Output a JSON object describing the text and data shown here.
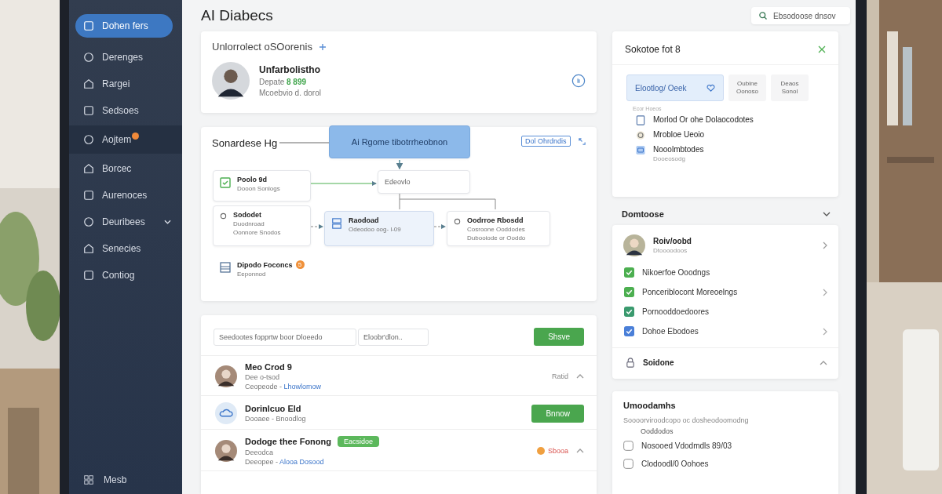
{
  "sidebar": {
    "items": [
      {
        "label": "Dohen fers",
        "selected": true,
        "highlighted": false,
        "badge": false,
        "expandable": false
      },
      {
        "label": "Derenges",
        "selected": false,
        "highlighted": false,
        "badge": false,
        "expandable": false
      },
      {
        "label": "Rargei",
        "selected": false,
        "highlighted": false,
        "badge": false,
        "expandable": false
      },
      {
        "label": "Sedsoes",
        "selected": false,
        "highlighted": false,
        "badge": false,
        "expandable": false
      },
      {
        "label": "Aojtem",
        "selected": false,
        "highlighted": true,
        "badge": true,
        "expandable": false
      },
      {
        "label": "Borcec",
        "selected": false,
        "highlighted": false,
        "badge": false,
        "expandable": false
      },
      {
        "label": "Aurenoces",
        "selected": false,
        "highlighted": false,
        "badge": false,
        "expandable": false
      },
      {
        "label": "Deuribees",
        "selected": false,
        "highlighted": false,
        "badge": false,
        "expandable": true
      },
      {
        "label": "Senecies",
        "selected": false,
        "highlighted": false,
        "badge": false,
        "expandable": false
      },
      {
        "label": "Contiog",
        "selected": false,
        "highlighted": false,
        "badge": false,
        "expandable": false
      }
    ],
    "footer": "Mesb"
  },
  "title": "AI Diabecs",
  "search": {
    "placeholder": "Ebsodoose dnsov"
  },
  "profile_card": {
    "title": "Unlorrolect oSOorenis",
    "name": "Unfarbolistho",
    "meta": "Depate",
    "meta_value": "8 899",
    "note": "Mcoebvio d. dorol"
  },
  "diagram": {
    "title": "Sonardese Hg",
    "link": "Dol Ohrdndis",
    "nodes": [
      {
        "kind": "primary",
        "title": "Ai Rgome tibotrrheobnon"
      },
      {
        "kind": "check",
        "title": "Poolo 9d",
        "lines": [
          "Dooon Sonlogs"
        ]
      },
      {
        "kind": "plain",
        "title": "Edeovlo"
      },
      {
        "kind": "radio",
        "title": "Sododet",
        "lines": [
          "Duodnroad",
          "Oonnore Snodos"
        ]
      },
      {
        "kind": "highlight",
        "title": "Raodoad",
        "lines": [
          "Odeodoo oog- l-09"
        ]
      },
      {
        "kind": "radio",
        "title": "Oodrroe Rbosdd",
        "lines": [
          "Cosroone Ooddodes",
          "Dubooiode or Ooddo"
        ]
      },
      {
        "kind": "list",
        "title": "Dipodo Foconcs",
        "lines": [
          "Eeponnod"
        ],
        "badge": "5"
      }
    ]
  },
  "list_card": {
    "filter": {
      "placeholder": "Seedootes fopprtw boor Dloeedo"
    },
    "filter2": {
      "placeholder": "Eloobr'dlon.."
    },
    "button": "Shsve",
    "rows": [
      {
        "kind": "person",
        "name": "Meo Crod 9",
        "sub": "Dee o-tsod",
        "meta": "Ceopeode -",
        "link": "Lhowlomow",
        "status": "Ratid",
        "alert": false,
        "expanded": true
      },
      {
        "kind": "item",
        "name": "Dorinlcuo Eld",
        "sub": "Dooaee - Bnoodlog",
        "action": "Bnnow"
      },
      {
        "kind": "person",
        "name": "Dodoge thee Fonong",
        "tag": "Eacsidoe",
        "sub": "Deeodca",
        "meta": "Deeopee -",
        "link": "Alooa Dosood",
        "status": "Sbooa",
        "alert": true,
        "expanded": true
      }
    ]
  },
  "settings_card": {
    "title": "Sokotoe fot 8",
    "tabs": [
      {
        "label": "Elootlog/ Oeek",
        "selected": true
      },
      {
        "label": "Oubine Oonoso",
        "selected": false
      },
      {
        "label": "Deaos Sonol",
        "selected": false
      }
    ],
    "caption": "Ecor Hoeos",
    "items": [
      {
        "kind": "doc",
        "label": "Morlod Or ohe Dolaocodotes"
      },
      {
        "kind": "ring",
        "label": "Mrobloe Ueoio"
      },
      {
        "kind": "square",
        "label": "Nooolmbtodes",
        "sub": "Dooeosodg"
      }
    ]
  },
  "section": {
    "title": "Domtoose",
    "expanded": false
  },
  "checklist_card": {
    "person": {
      "name": "Roiv/oobd",
      "sub": "Dtoooodoos"
    },
    "items": [
      {
        "label": "Nikoerfoe Ooodngs",
        "checked": true,
        "color": "#4caf50",
        "chevron": false
      },
      {
        "label": "Ponceriblocont Moreoelngs",
        "checked": true,
        "color": "#4caf50",
        "chevron": true
      },
      {
        "label": "Pornooddoedoores",
        "checked": true,
        "color": "#3a9a6e",
        "chevron": false
      },
      {
        "label": "Dohoe Ebodoes",
        "checked": true,
        "color": "#4a7fd8",
        "chevron": true
      }
    ],
    "footer": {
      "label": "Soidone",
      "expanded": true
    }
  },
  "options_card": {
    "title": "Umoodamhs",
    "description": "Soooorviroodcopo oc dosheodoomodng",
    "group": "Ooddodos",
    "options": [
      {
        "label": "Nosooed Vdodmdls 89/03",
        "checked": false
      },
      {
        "label": "Clodoodl/0 Oohoes",
        "checked": false
      }
    ]
  }
}
